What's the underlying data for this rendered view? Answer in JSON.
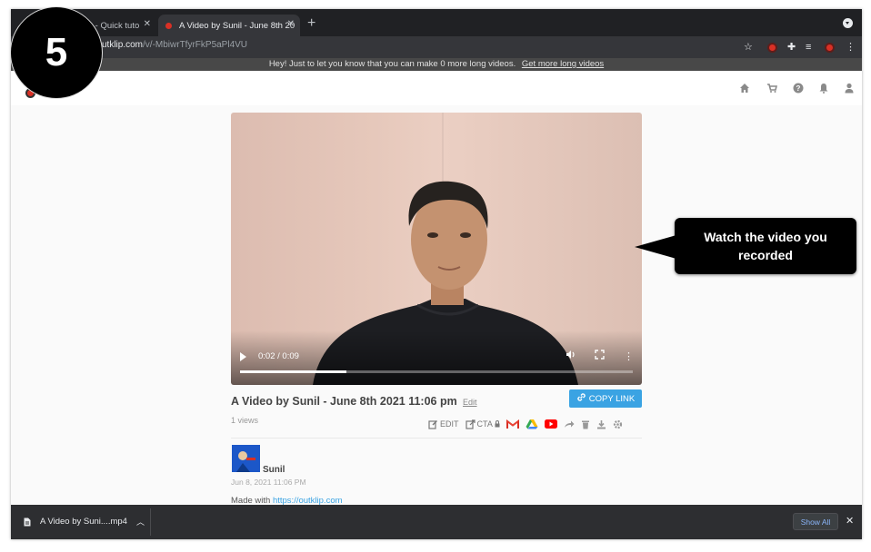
{
  "browser": {
    "tabs": [
      {
        "label": "es - Quick tuto",
        "active": false
      },
      {
        "label": "A Video by Sunil - June 8th 20",
        "active": true
      }
    ],
    "new_tab": "+",
    "url_host": "utklip.com",
    "url_path": "/v/-MbiwrTfyrFkP5aPl4VU"
  },
  "notice": {
    "text": "Hey! Just to let you know that you can make 0 more long videos.",
    "link": "Get more long videos"
  },
  "header_icons": [
    "home-icon",
    "cart-icon",
    "help-icon",
    "bell-icon",
    "user-icon"
  ],
  "video": {
    "time": "0:02 / 0:09",
    "progress": 0.27
  },
  "callout": {
    "line1": "Watch the video you",
    "line2": "recorded"
  },
  "step": "5",
  "info": {
    "title": "A Video by Sunil - June 8th 2021 11:06 pm",
    "edit_label": "Edit",
    "copy_link_label": "COPY LINK",
    "views": "1 views",
    "edit_action": "EDIT",
    "cta_action": "CTA",
    "author": "Sunil",
    "date": "Jun 8, 2021 11:06 PM",
    "made_with_prefix": "Made with",
    "made_with_link": "https://outklip.com"
  },
  "downloads": {
    "file": "A Video by Suni....mp4",
    "show_all": "Show All"
  },
  "colors": {
    "accent": "#3aa3e3",
    "recording_red": "#d93025",
    "callout": "#000000"
  }
}
